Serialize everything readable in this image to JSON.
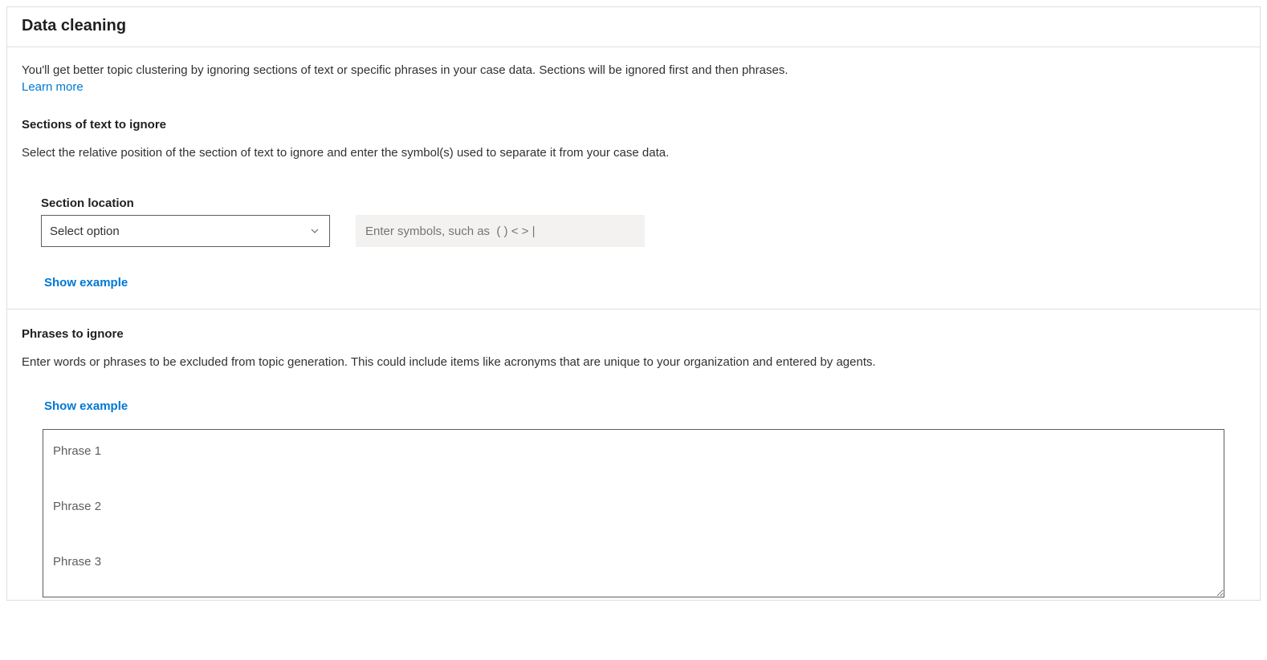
{
  "header": {
    "title": "Data cleaning"
  },
  "intro": {
    "text": "You'll get better topic clustering by ignoring sections of text or specific phrases in your case data. Sections will be ignored first and then phrases.",
    "learn_more": "Learn more"
  },
  "sections": {
    "heading": "Sections of text to ignore",
    "description": "Select the relative position of the section of text to ignore and enter the symbol(s) used to separate it from your case data.",
    "location_label": "Section location",
    "select_placeholder": "Select option",
    "symbols_placeholder": "Enter symbols, such as  ( ) < > |",
    "show_example": "Show example"
  },
  "phrases": {
    "heading": "Phrases to ignore",
    "description": "Enter words or phrases to be excluded from topic generation. This could include items like acronyms that are unique to your organization and entered by agents.",
    "show_example": "Show example",
    "textarea_placeholder": "Phrase 1\n\nPhrase 2\n\nPhrase 3"
  }
}
